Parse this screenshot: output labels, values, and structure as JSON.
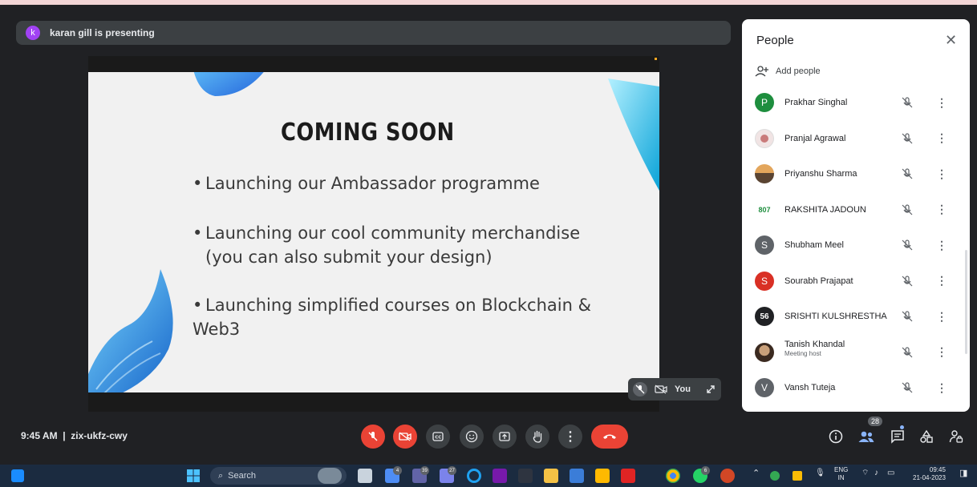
{
  "presenting": {
    "avatar_letter": "k",
    "text": "karan gill is presenting"
  },
  "slide": {
    "title": "COMING SOON",
    "bullet_1": "Launching our Ambassador programme",
    "bullet_2_line1": "Launching our cool community merchandise",
    "bullet_2_line2": "(you can also submit your design)",
    "bullet_3_line1": "Launching simplified courses on Blockchain &",
    "bullet_3_line2": "Web3"
  },
  "self_tile": {
    "label": "You"
  },
  "people_panel": {
    "title": "People",
    "add_people": "Add people",
    "participants": [
      {
        "name": "Prakhar Singhal",
        "avatar": "P",
        "color": "#1e8e3e"
      },
      {
        "name": "Pranjal Agrawal",
        "avatar": "",
        "color": "#f1e4e4"
      },
      {
        "name": "Priyanshu Sharma",
        "avatar": "",
        "color": "#b06a3a"
      },
      {
        "name": "RAKSHITA JADOUN",
        "avatar": "807",
        "color": "#ffffff"
      },
      {
        "name": "Shubham Meel",
        "avatar": "S",
        "color": "#5f6368"
      },
      {
        "name": "Sourabh Prajapat",
        "avatar": "S",
        "color": "#d93025"
      },
      {
        "name": "SRISHTI KULSHRESTHA",
        "avatar": "56",
        "color": "#202124"
      },
      {
        "name": "Tanish Khandal",
        "subtitle": "Meeting host",
        "avatar": "",
        "color": "#8d6e63"
      },
      {
        "name": "Vansh Tuteja",
        "avatar": "V",
        "color": "#5f6368"
      }
    ]
  },
  "bottom_bar": {
    "meeting_info": "9:45 AM  |  zix-ukfz-cwy",
    "people_count": "28"
  },
  "taskbar": {
    "search_label": "Search",
    "badges": [
      "4",
      "39",
      "27",
      "6"
    ],
    "lang_line1": "ENG",
    "lang_line2": "IN",
    "time": "09:45",
    "date": "21-04-2023"
  },
  "colors": {
    "accent_red": "#ea4335",
    "panel_bg": "#ffffff",
    "meet_bg": "#202124"
  }
}
